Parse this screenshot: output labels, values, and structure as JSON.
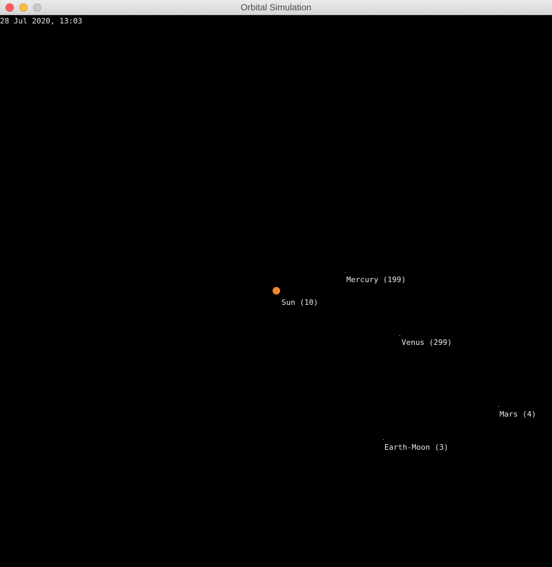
{
  "window": {
    "title": "Orbital Simulation"
  },
  "hud": {
    "datetime": "28 Jul 2020, 13:03"
  },
  "colors": {
    "background": "#000000",
    "sun": "#f4872c",
    "label": "#e8e8e8"
  },
  "bodies": {
    "sun": {
      "label": "Sun (10)"
    },
    "mercury": {
      "label": "Mercury (199)"
    },
    "venus": {
      "label": "Venus (299)"
    },
    "mars": {
      "label": "Mars (4)"
    },
    "earth_moon": {
      "label": "Earth-Moon (3)"
    }
  }
}
